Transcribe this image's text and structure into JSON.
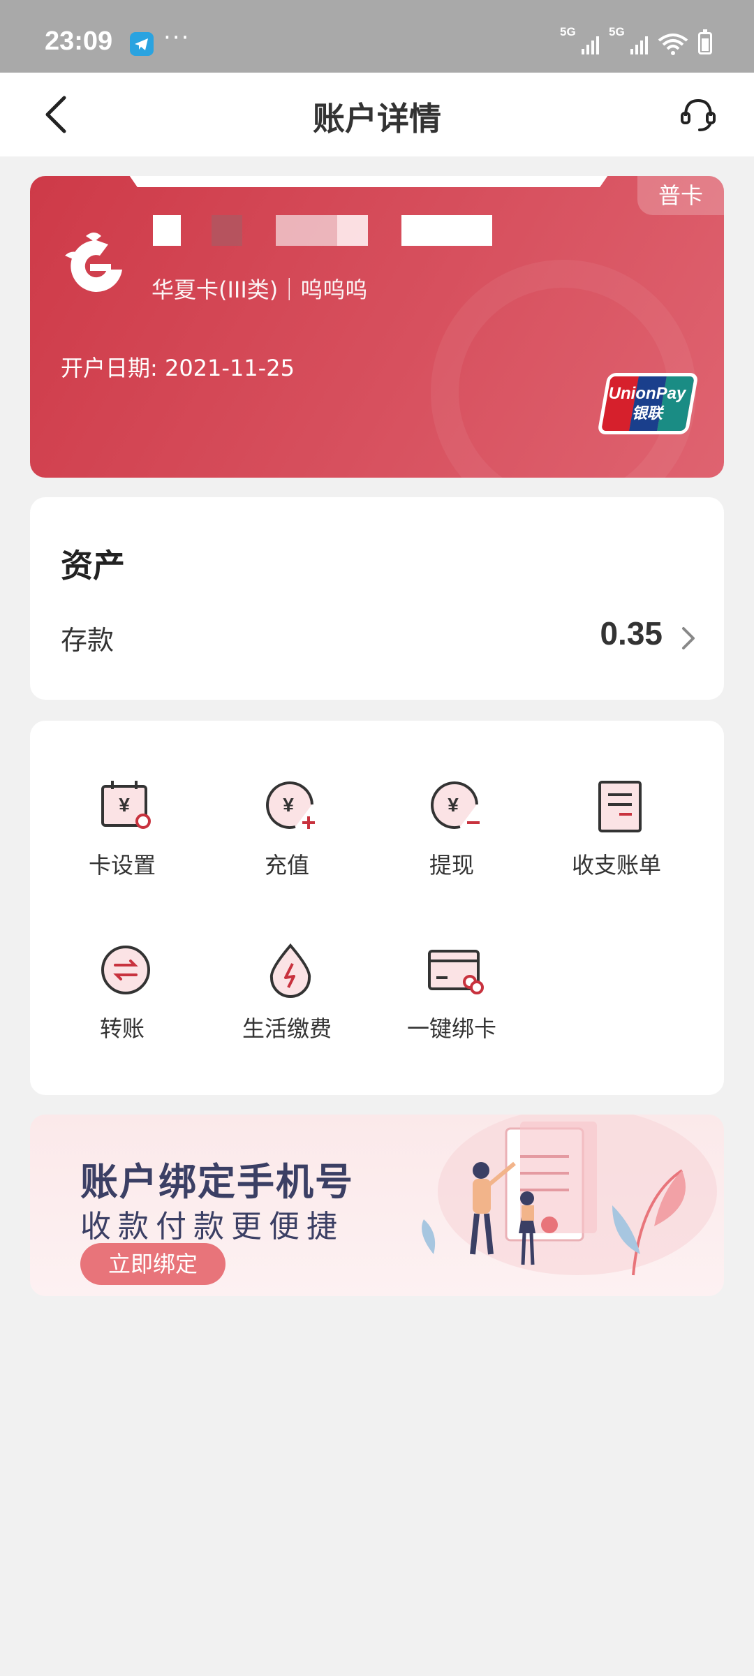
{
  "status_bar": {
    "time": "23:09",
    "more": "···",
    "signal1": "5G",
    "signal2": "5G"
  },
  "nav": {
    "title": "账户详情",
    "back_icon": "chevron-left-icon",
    "service_icon": "headset-icon"
  },
  "card": {
    "badge": "普卡",
    "name": "华夏卡(III类)｜呜呜呜",
    "open_date": "开户日期: 2021-11-25",
    "network_en": "UnionPay",
    "network_cn": "银联",
    "logo_icon": "huaxia-bank-logo-icon",
    "colors": {
      "card": "#d24553",
      "unionpay_red": "#d6202c",
      "unionpay_blue": "#1a3f8c",
      "unionpay_teal": "#1a8c84"
    }
  },
  "assets": {
    "title": "资产",
    "deposit_label": "存款",
    "deposit_value": "0.35"
  },
  "functions": [
    {
      "label": "卡设置",
      "icon": "card-settings-icon"
    },
    {
      "label": "充值",
      "icon": "top-up-icon"
    },
    {
      "label": "提现",
      "icon": "withdraw-icon"
    },
    {
      "label": "收支账单",
      "icon": "bill-icon"
    },
    {
      "label": "转账",
      "icon": "transfer-icon"
    },
    {
      "label": "生活缴费",
      "icon": "utility-payment-icon"
    },
    {
      "label": "一键绑卡",
      "icon": "bind-card-icon"
    }
  ],
  "banner": {
    "title": "账户绑定手机号",
    "subtitle": "收款付款更便捷",
    "button": "立即绑定"
  },
  "accent_color": "#c8323e"
}
